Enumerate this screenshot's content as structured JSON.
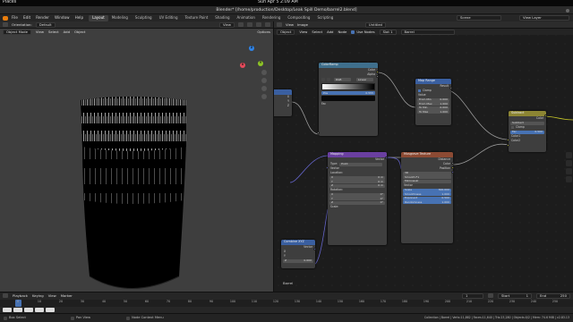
{
  "os": {
    "places": "Places",
    "clock": "Sun Apr 5   2:09 AM"
  },
  "window": {
    "title": "Blender* [/home/production/Desktop/Leak Spill Demo/barrel2.blend]"
  },
  "menu": {
    "items": [
      "File",
      "Edit",
      "Render",
      "Window",
      "Help"
    ]
  },
  "workspaces": [
    "Layout",
    "Modeling",
    "Sculpting",
    "UV Editing",
    "Texture Paint",
    "Shading",
    "Animation",
    "Rendering",
    "Compositing",
    "Scripting"
  ],
  "scene": {
    "label": "Scene",
    "view_layer": "View Layer"
  },
  "viewport": {
    "orientation_label": "Orientation:",
    "orientation_value": "Default",
    "mode": "Object Mode",
    "menus": [
      "View",
      "Select",
      "Add",
      "Object"
    ],
    "options": "Options",
    "gizmo": {
      "x": "X",
      "y": "Y",
      "z": "Z"
    }
  },
  "node_editor": {
    "header_menus": [
      "View",
      "Image",
      "Untitled"
    ],
    "menus": [
      "View",
      "Select",
      "Add",
      "Node"
    ],
    "object_label": "Object",
    "use_nodes": "Use Nodes",
    "slot": "Slot 1",
    "material": "Barrel",
    "material_label": "Barrel"
  },
  "nodes": {
    "colorramp": {
      "title": "ColorRamp",
      "out_color": "Color",
      "out_alpha": "Alpha",
      "mode": "RGB",
      "interp": "Linear",
      "pos_label": "Pos",
      "pos_value": "0.555",
      "fac": "Fac"
    },
    "map_range": {
      "title": "Map Range",
      "out": "Result",
      "clamp": "Clamp",
      "value": "Value",
      "rows": [
        [
          "From Min",
          "0.000"
        ],
        [
          "From Max",
          "1.000"
        ],
        [
          "To Min",
          "0.000"
        ],
        [
          "To Max",
          "1.000"
        ]
      ]
    },
    "mix": {
      "title": "Subtract",
      "out": "Color",
      "blend": "Subtract",
      "clamp": "Clamp",
      "fac": "Fac",
      "fac_value": "0.500",
      "c1": "Color1",
      "c2": "Color2"
    },
    "mapping": {
      "title": "Mapping",
      "out": "Vector",
      "type_label": "Type:",
      "type_value": "Point",
      "vector": "Vector",
      "location": "Location:",
      "rotation": "Rotation:",
      "scale": "Scale:",
      "loc": [
        [
          "X",
          "0 m"
        ],
        [
          "Y",
          "0 m"
        ],
        [
          "Z",
          "0 m"
        ]
      ],
      "rot": [
        [
          "X",
          "0°"
        ],
        [
          "Y",
          "0°"
        ],
        [
          "Z",
          "0°"
        ]
      ]
    },
    "musgrave": {
      "title": "Musgrave Texture",
      "outs": [
        "Distance",
        "Color",
        "Position"
      ],
      "dim": "3D",
      "feature": "Smooth F1",
      "metric": "Minkowski",
      "vector": "Vector",
      "rows": [
        [
          "Scale",
          "300.000"
        ],
        [
          "Smoothness",
          "1.000"
        ],
        [
          "Exponent",
          "0.500"
        ],
        [
          "Randomness",
          "1.000"
        ]
      ]
    },
    "texcoord": {
      "title": "Combine XYZ",
      "out": "Vector",
      "x": "X",
      "y": "Y",
      "z": "Z",
      "z_value": "0.000"
    },
    "left_stub": {
      "rows": [
        "X",
        "Y",
        "Z"
      ]
    },
    "barrel_label": "Barrel"
  },
  "timeline": {
    "menus": [
      "Playback",
      "Keying",
      "View",
      "Marker"
    ],
    "frame": "1",
    "start_label": "Start",
    "start": "1",
    "end_label": "End",
    "end": "250",
    "ticks": [
      "0",
      "10",
      "20",
      "30",
      "40",
      "50",
      "60",
      "70",
      "80",
      "90",
      "100",
      "110",
      "120",
      "130",
      "140",
      "150",
      "160",
      "170",
      "180",
      "190",
      "200",
      "210",
      "220",
      "230",
      "240",
      "250"
    ]
  },
  "status": {
    "left": "Box Select",
    "mid1": "Pan View",
    "mid2": "Node Context Menu",
    "right": "Collection | Barrel | Verts:11,862 | Faces:11,640 | Tris:23,280 | Objects:0/2 | Mem: 74.6 MiB | v2.83.13"
  }
}
